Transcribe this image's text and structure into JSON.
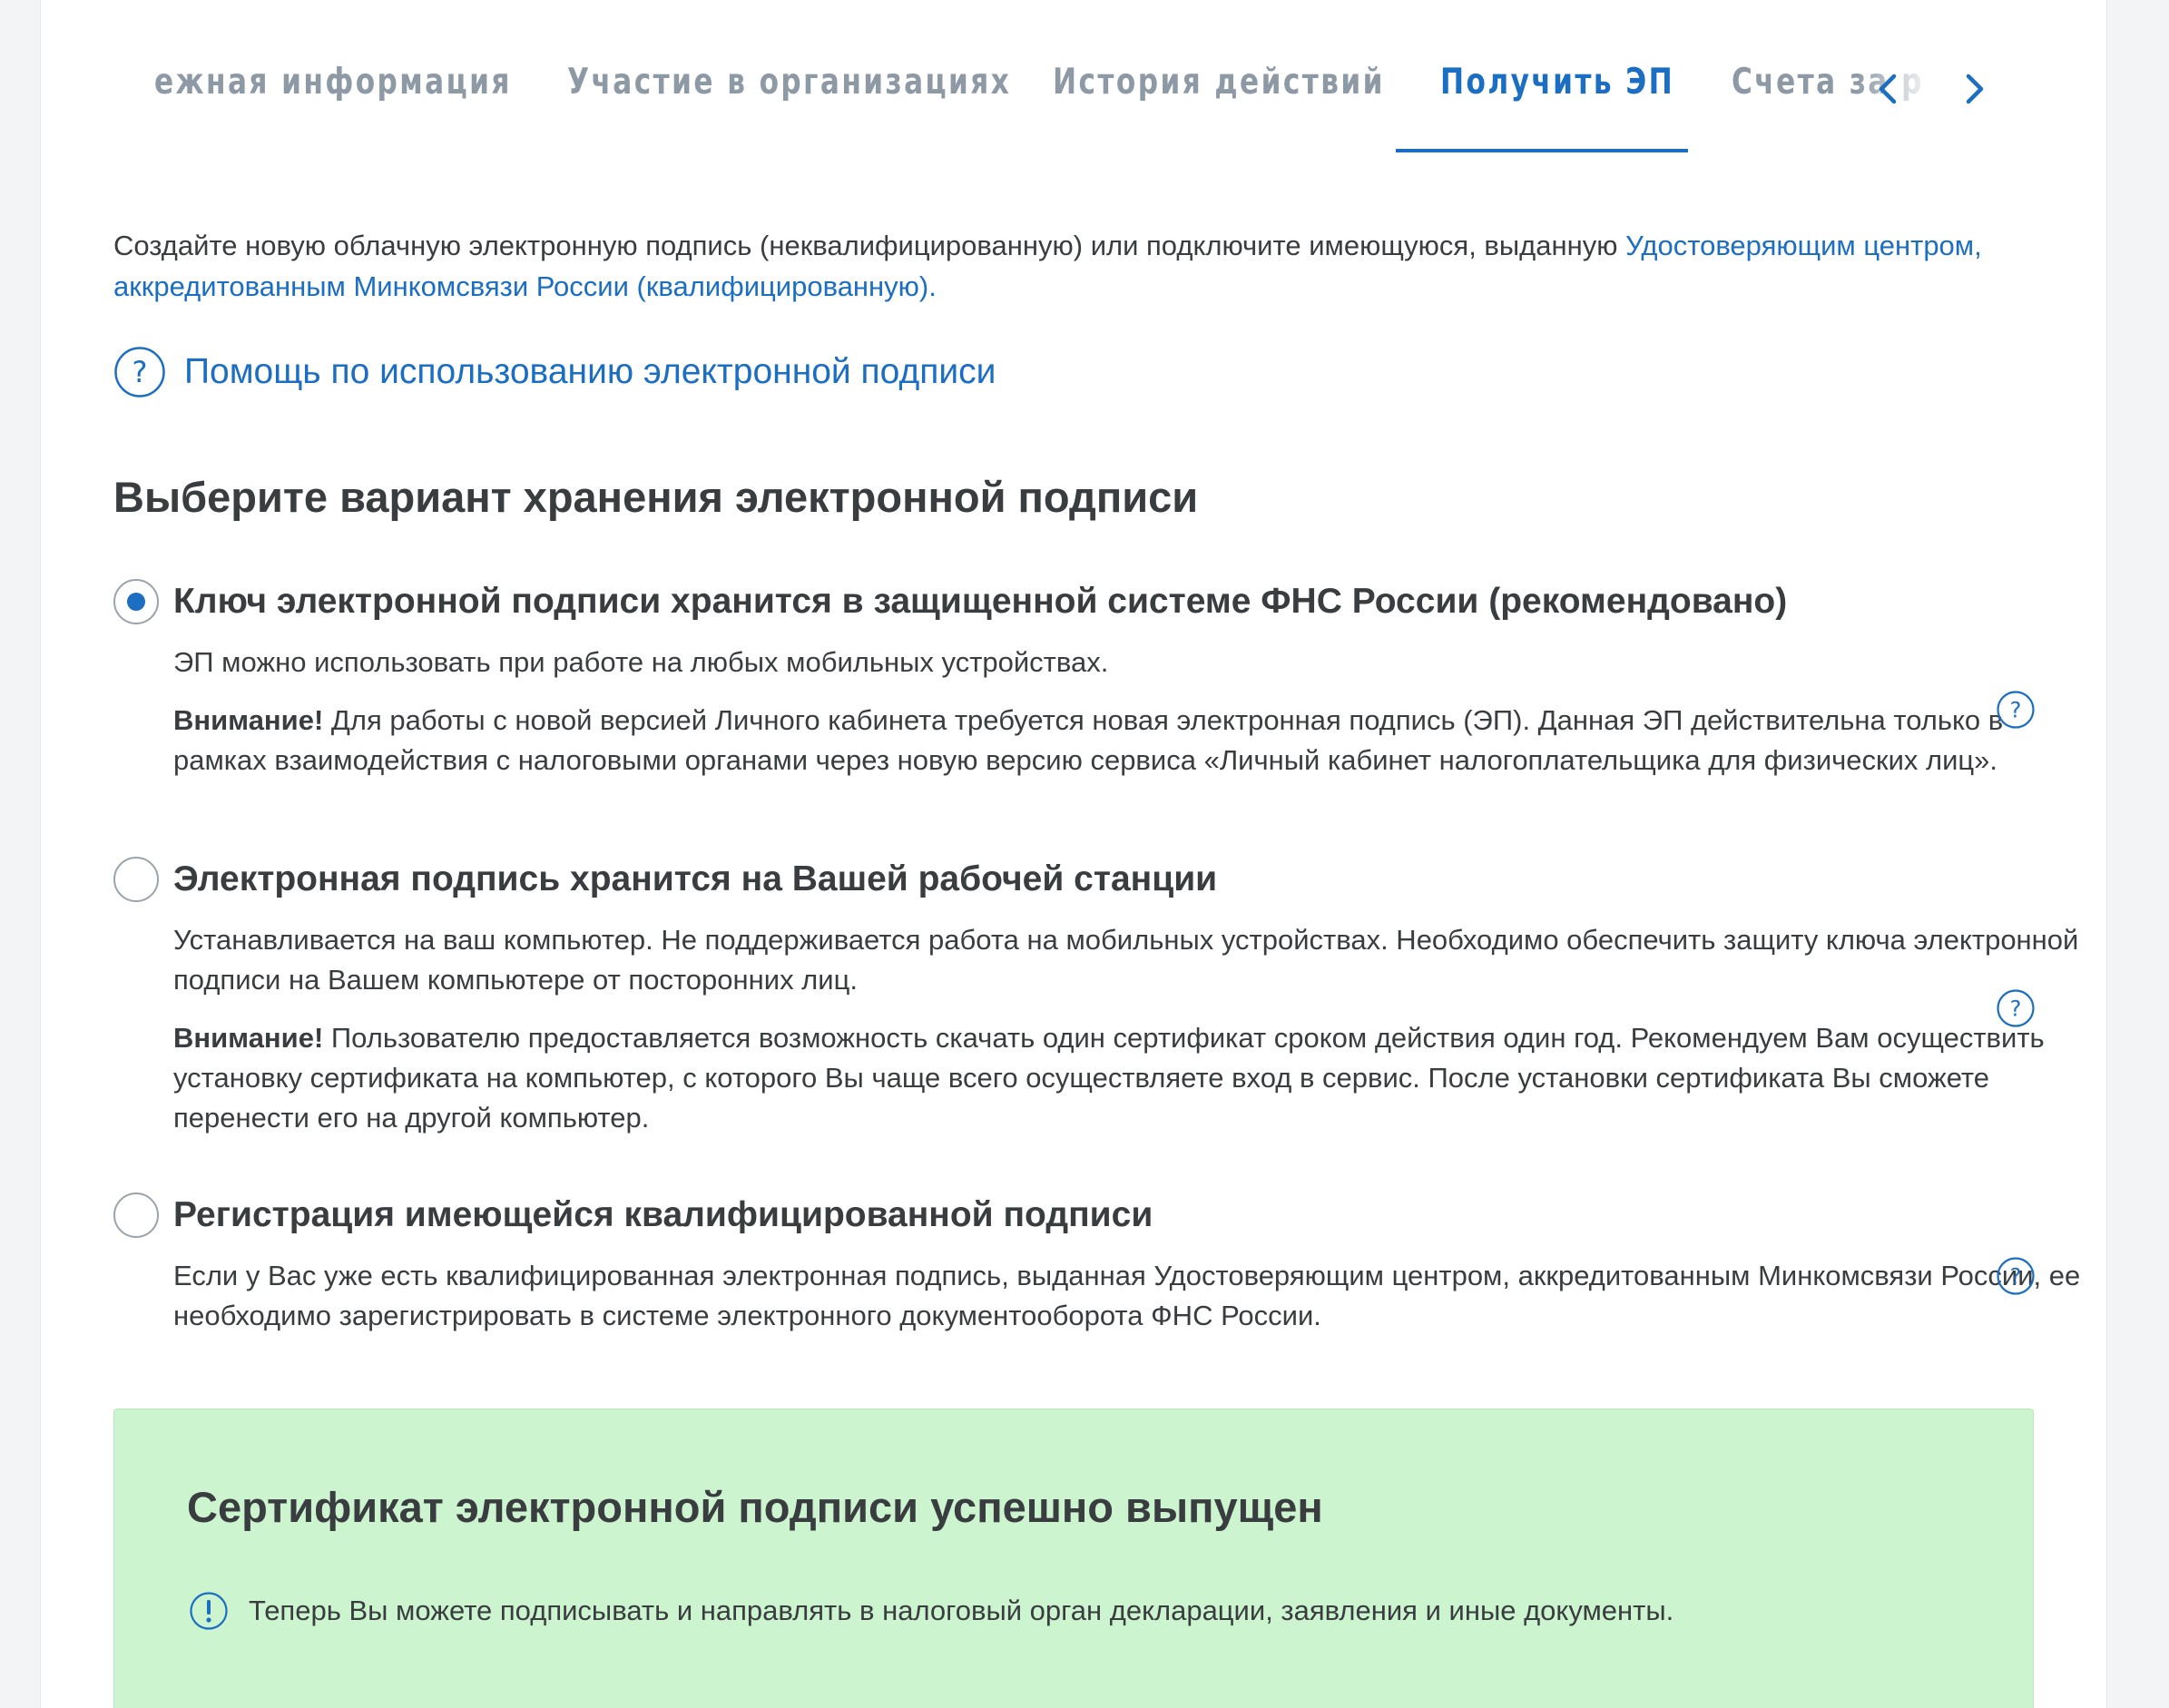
{
  "tabs": {
    "items": [
      {
        "label": "ежная информация"
      },
      {
        "label": "Участие в организациях"
      },
      {
        "label": "История действий"
      },
      {
        "label": "Получить ЭП"
      },
      {
        "label": "Счета за р"
      }
    ],
    "active_index": 3,
    "prev_icon": "chevron-left-icon",
    "next_icon": "chevron-right-icon"
  },
  "intro": {
    "text": "Создайте новую облачную электронную подпись (неквалифицированную) или подключите имеющуюся, выданную ",
    "link": "Удостоверяющим центром, аккредитованным Минкомсвязи России (квалифицированную)."
  },
  "help": {
    "label": "Помощь по использованию электронной подписи",
    "icon": "question-circle-icon"
  },
  "section_title": "Выберите вариант хранения электронной подписи",
  "options": [
    {
      "title": "Ключ электронной подписи хранится в защищенной системе ФНС России (рекомендовано)",
      "checked": true,
      "desc": "ЭП можно использовать при работе на любых мобильных устройствах.",
      "warning_label": "Внимание!",
      "warning_text": " Для работы с новой версией Личного кабинета требуется новая электронная подпись (ЭП). Данная ЭП  действительна только в рамках взаимодействия с налоговыми органами через новую версию сервиса  «Личный кабинет налогоплательщика для физических лиц»."
    },
    {
      "title": "Электронная подпись хранится на Вашей рабочей станции",
      "checked": false,
      "desc": "Устанавливается на ваш компьютер. Не поддерживается работа на мобильных устройствах. Необходимо обеспечить  защиту ключа электронной подписи на Вашем компьютере от посторонних лиц.",
      "warning_label": "Внимание!",
      "warning_text": " Пользователю предоставляется возможность скачать один сертификат  сроком действия один год. Рекомендуем Вам осуществить установку сертификата на компьютер, с которого Вы  чаще всего осуществляете вход в сервис. После установки сертификата Вы сможете перенести его на другой  компьютер."
    },
    {
      "title": "Регистрация имеющейся квалифицированной подписи",
      "checked": false,
      "desc": "Если у Вас уже есть квалифицированная электронная подпись, выданная Удостоверяющим центром, аккредитованным Минкомсвязи России, ее необходимо зарегистрировать в системе электронного документооборота ФНС России."
    }
  ],
  "success": {
    "title": "Сертификат электронной подписи успешно выпущен",
    "message": "Теперь Вы можете подписывать и направлять в налоговый орган декларации, заявления и иные документы.",
    "icon": "exclamation-circle-icon"
  },
  "colors": {
    "accent": "#1b6ec2",
    "tab_inactive": "#8d99a4",
    "text": "#3a3d40",
    "success_bg": "#ccf5cf"
  }
}
